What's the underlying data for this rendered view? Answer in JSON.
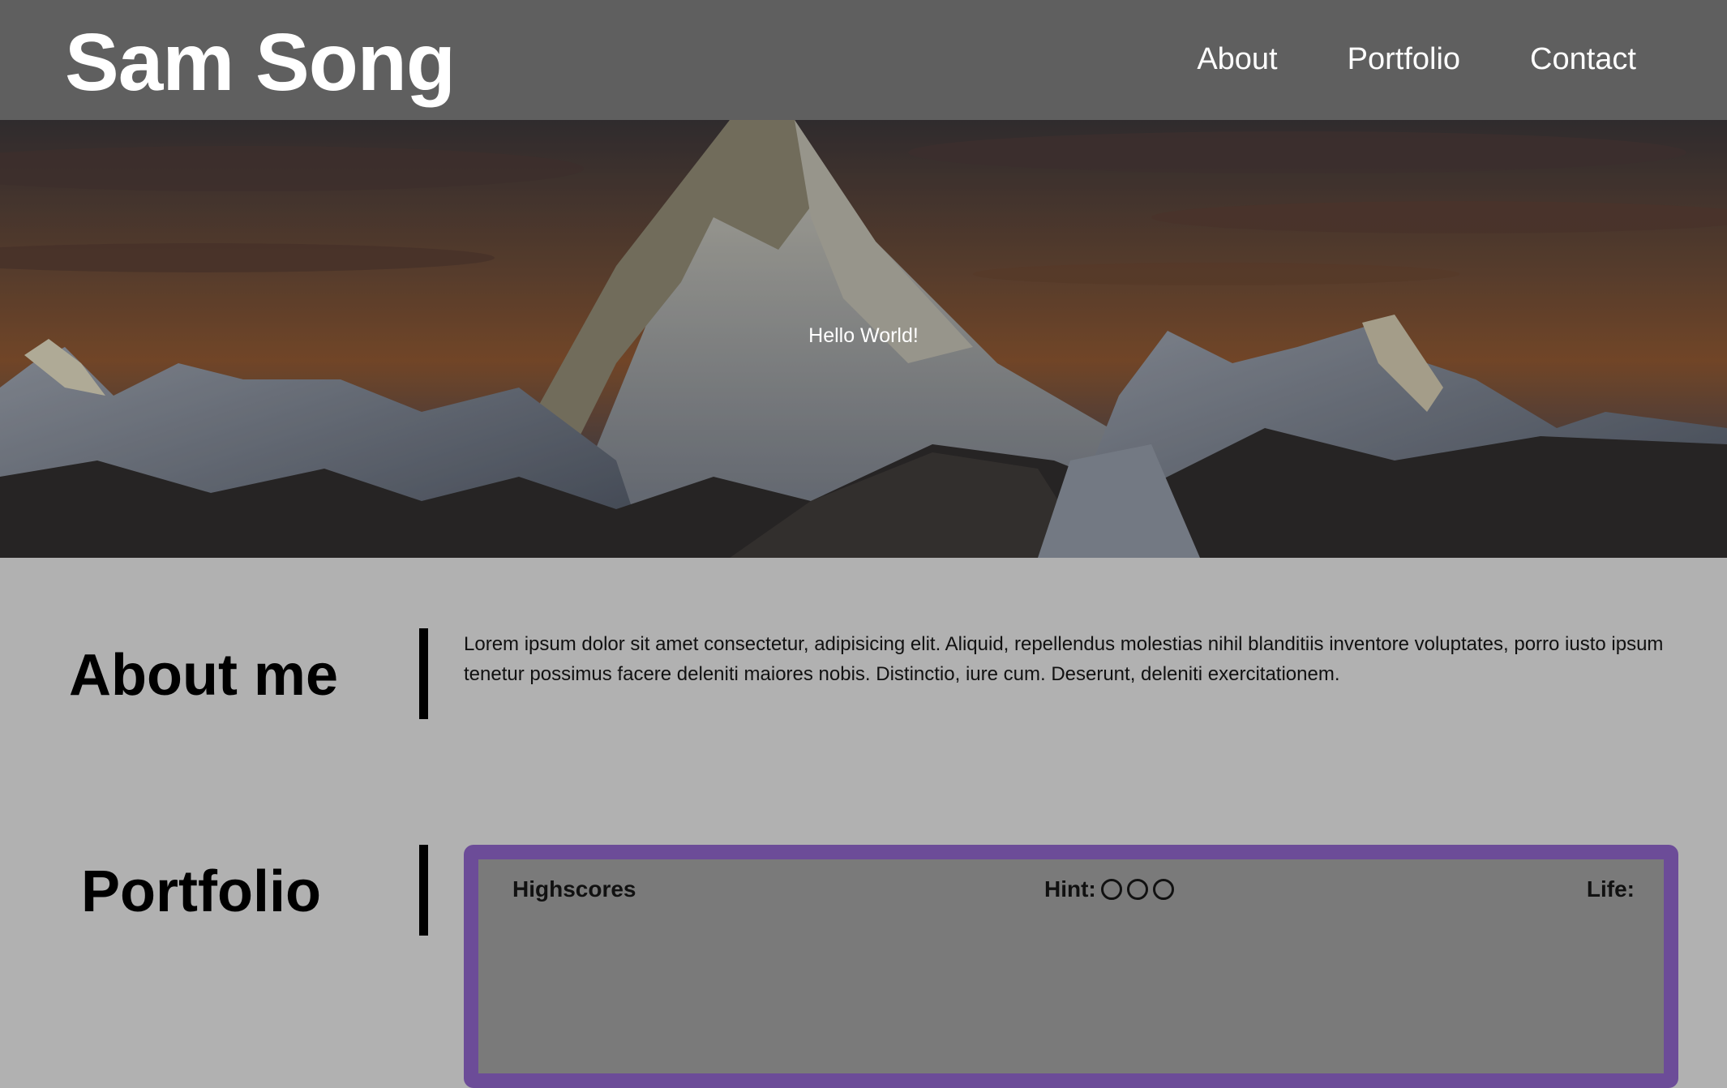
{
  "header": {
    "brand": "Sam Song",
    "nav": [
      {
        "label": "About"
      },
      {
        "label": "Portfolio"
      },
      {
        "label": "Contact"
      }
    ]
  },
  "hero": {
    "text": "Hello World!"
  },
  "about": {
    "title": "About me",
    "body": "Lorem ipsum dolor sit amet consectetur, adipisicing elit. Aliquid, repellendus molestias nihil blanditiis inventore voluptates, porro iusto ipsum tenetur possimus facere deleniti maiores nobis. Distinctio, iure cum. Deserunt, deleniti exercitationem."
  },
  "portfolio": {
    "title": "Portfolio",
    "game": {
      "highscores_label": "Highscores",
      "hint_label": "Hint:",
      "hints_remaining": 3,
      "life_label": "Life:",
      "frame_color": "#6c4c98"
    }
  },
  "colors": {
    "header_bg": "#5f5f5f",
    "page_bg": "#b1b1b1",
    "game_bg": "#7a7a7a"
  }
}
